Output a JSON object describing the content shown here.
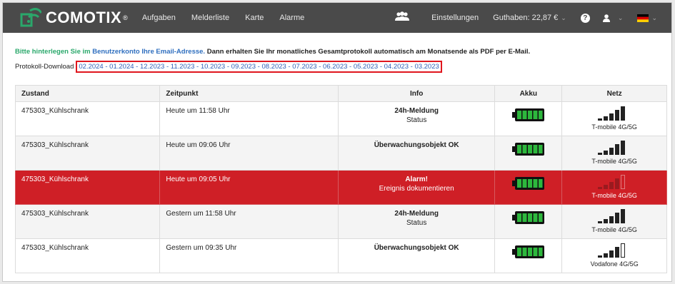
{
  "nav": {
    "brand": "COMOTIX",
    "brand_reg": "®",
    "links": [
      "Aufgaben",
      "Melderliste",
      "Karte",
      "Alarme"
    ],
    "settings": "Einstellungen",
    "balance": "Guthaben: 22,87 €",
    "help": "?",
    "icons": [
      "people-icon",
      "help-icon",
      "user-icon",
      "german-flag-icon"
    ],
    "colors": {
      "bar": "#4a4a4a",
      "text": "#e8e8e8"
    }
  },
  "info": {
    "part1": "Bitte hinterlegen Sie im",
    "part2": " Benutzerkonto Ihre Email-Adresse.",
    "part3": " Dann erhalten Sie Ihr monatliches Gesamtprotokoll automatisch am Monatsende als PDF per E-Mail."
  },
  "protocol": {
    "label": "Protokoll-Download",
    "months": [
      "02.2024",
      "01.2024",
      "12.2023",
      "11.2023",
      "10.2023",
      "09.2023",
      "08.2023",
      "07.2023",
      "06.2023",
      "05.2023",
      "04.2023",
      "03.2023"
    ],
    "separator": " - "
  },
  "table": {
    "headers": {
      "zustand": "Zustand",
      "zeitpunkt": "Zeitpunkt",
      "info": "Info",
      "akku": "Akku",
      "netz": "Netz"
    },
    "rows": [
      {
        "zustand": "475303_Kühlschrank",
        "zeitpunkt": "Heute um 11:58 Uhr",
        "info_title": "24h-Meldung",
        "info_sub": "Status",
        "netz": "T-mobile 4G/5G"
      },
      {
        "zustand": "475303_Kühlschrank",
        "zeitpunkt": "Heute um 09:06 Uhr",
        "info_title": "Überwachungsobjekt OK",
        "info_sub": "",
        "netz": "T-mobile 4G/5G"
      },
      {
        "zustand": "475303_Kühlschrank",
        "zeitpunkt": "Heute um 09:05 Uhr",
        "info_title": "Alarm!",
        "info_sub": "Ereignis dokumentieren",
        "netz": "T-mobile 4G/5G"
      },
      {
        "zustand": "475303_Kühlschrank",
        "zeitpunkt": "Gestern um 11:58 Uhr",
        "info_title": "24h-Meldung",
        "info_sub": "Status",
        "netz": "T-mobile 4G/5G"
      },
      {
        "zustand": "475303_Kühlschrank",
        "zeitpunkt": "Gestern um 09:35 Uhr",
        "info_title": "Überwachungsobjekt OK",
        "info_sub": "",
        "netz": "Vodafone 4G/5G"
      }
    ],
    "colors": {
      "alarm_row": "#cf1f26",
      "battery": "#2db83d"
    },
    "battery_level": [
      1,
      1,
      1,
      1,
      1
    ],
    "signal_bars_filled": [
      5,
      5,
      4,
      5,
      4
    ]
  }
}
